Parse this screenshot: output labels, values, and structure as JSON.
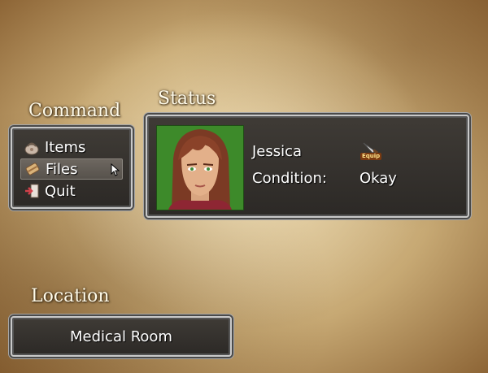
{
  "command": {
    "heading": "Command",
    "items": [
      {
        "label": "Items",
        "icon": "bag-icon"
      },
      {
        "label": "Files",
        "icon": "scroll-icon",
        "selected": true
      },
      {
        "label": "Quit",
        "icon": "exit-door-icon"
      }
    ]
  },
  "status": {
    "heading": "Status",
    "character_name": "Jessica",
    "condition_label": "Condition:",
    "condition_value": "Okay",
    "equip_badge": "Equip",
    "equip_icon": "knife-icon"
  },
  "location": {
    "heading": "Location",
    "name": "Medical Room"
  },
  "colors": {
    "panel_bg": "#34302c",
    "panel_border": "#c9c9c9",
    "portrait_bg": "#3d8a2a",
    "equip_badge": "#e0a020"
  }
}
